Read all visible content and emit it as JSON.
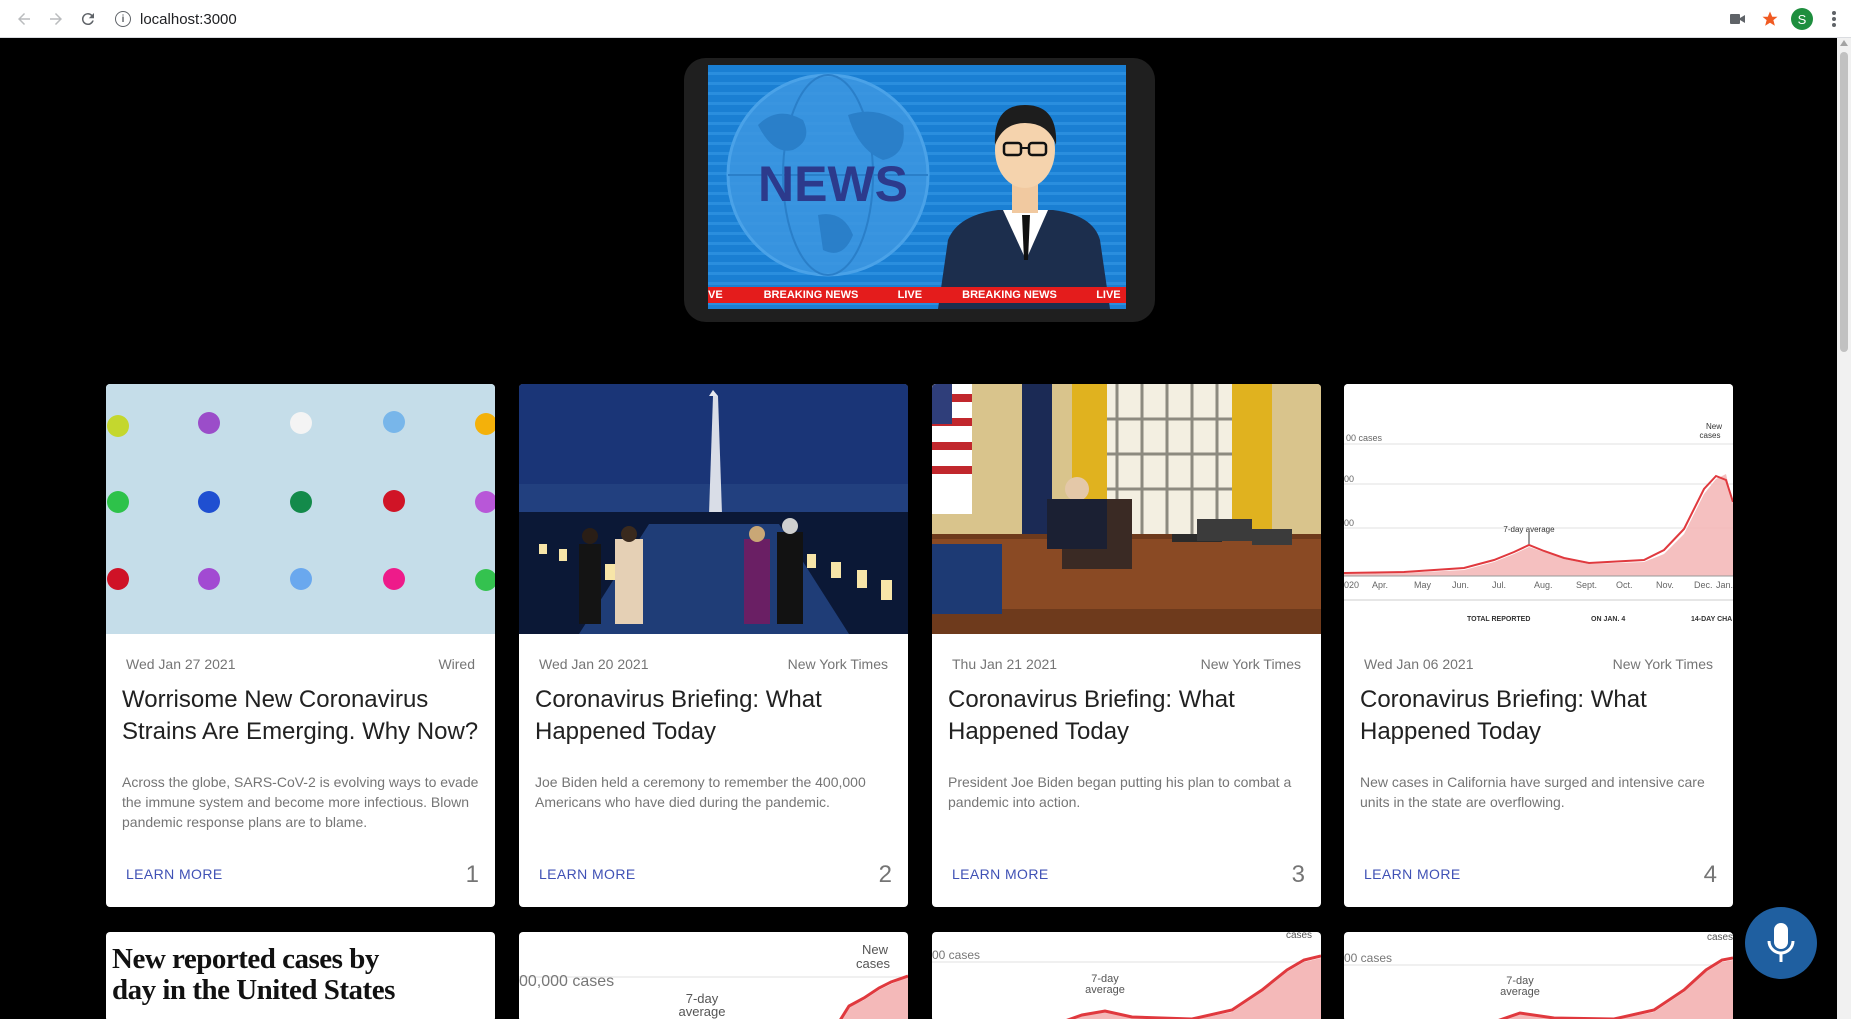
{
  "browser": {
    "url": "localhost:3000",
    "profile_initial": "S",
    "icons": [
      "back-arrow-icon",
      "forward-arrow-icon",
      "reload-icon",
      "info-icon",
      "camera-icon",
      "star-icon",
      "profile-avatar",
      "kebab-menu-icon"
    ]
  },
  "hero": {
    "screen_text": "NEWS",
    "ticker": [
      "VE",
      "BREAKING NEWS",
      "LIVE",
      "BREAKING NEWS",
      "LIVE"
    ]
  },
  "cards": [
    {
      "date": "Wed Jan 27 2021",
      "source": "Wired",
      "title": "Worrisome New Coronavirus Strains Are Emerging. Why Now?",
      "description": "Across the globe, SARS-CoV-2 is evolving ways to evade the immune system and become more infectious. Blown pandemic response plans are to blame.",
      "action": "LEARN MORE",
      "number": "1",
      "image": "colored-pushpins"
    },
    {
      "date": "Wed Jan 20 2021",
      "source": "New York Times",
      "title": "Coronavirus Briefing: What Happened Today",
      "description": "Joe Biden held a ceremony to remember the 400,000 Americans who have died during the pandemic.",
      "action": "LEARN MORE",
      "number": "2",
      "image": "washington-monument-night"
    },
    {
      "date": "Thu Jan 21 2021",
      "source": "New York Times",
      "title": "Coronavirus Briefing: What Happened Today",
      "description": "President Joe Biden began putting his plan to combat a pandemic into action.",
      "action": "LEARN MORE",
      "number": "3",
      "image": "oval-office-desk"
    },
    {
      "date": "Wed Jan 06 2021",
      "source": "New York Times",
      "title": "Coronavirus Briefing: What Happened Today",
      "description": "New cases in California have surged and intensive care units in the state are overflowing.",
      "action": "LEARN MORE",
      "number": "4",
      "image": "cases-chart",
      "chart_labels": {
        "top": "00 cases",
        "mid1": "00",
        "mid2": "00",
        "avg": "7-day average",
        "new_a": "New",
        "new_b": "cases",
        "months": [
          "020",
          "Apr.",
          "May",
          "Jun.",
          "Jul.",
          "Aug.",
          "Sept.",
          "Oct.",
          "Nov.",
          "Dec.",
          "Jan."
        ],
        "footer": [
          "TOTAL REPORTED",
          "ON JAN. 4",
          "14-DAY CHA"
        ]
      }
    }
  ],
  "row2": {
    "card1_heading_line1": "New reported cases by",
    "card1_heading_line2": "day in the United States",
    "card2_cases": "00,000 cases",
    "card2_avg_a": "7-day",
    "card2_avg_b": "average",
    "card2_new_a": "New",
    "card2_new_b": "cases",
    "card3_cases": "00 cases",
    "card3_avg_a": "7-day",
    "card3_avg_b": "average",
    "card3_new": "cases",
    "card4_cases": "00 cases",
    "card4_avg_a": "7-day",
    "card4_avg_b": "average",
    "card4_new": "cases"
  },
  "fab": {
    "icon": "microphone-icon"
  },
  "colors": {
    "page_bg": "#000000",
    "link": "#3f51b5",
    "fab": "#1f5fa0",
    "chart_red": "#e0393e"
  }
}
